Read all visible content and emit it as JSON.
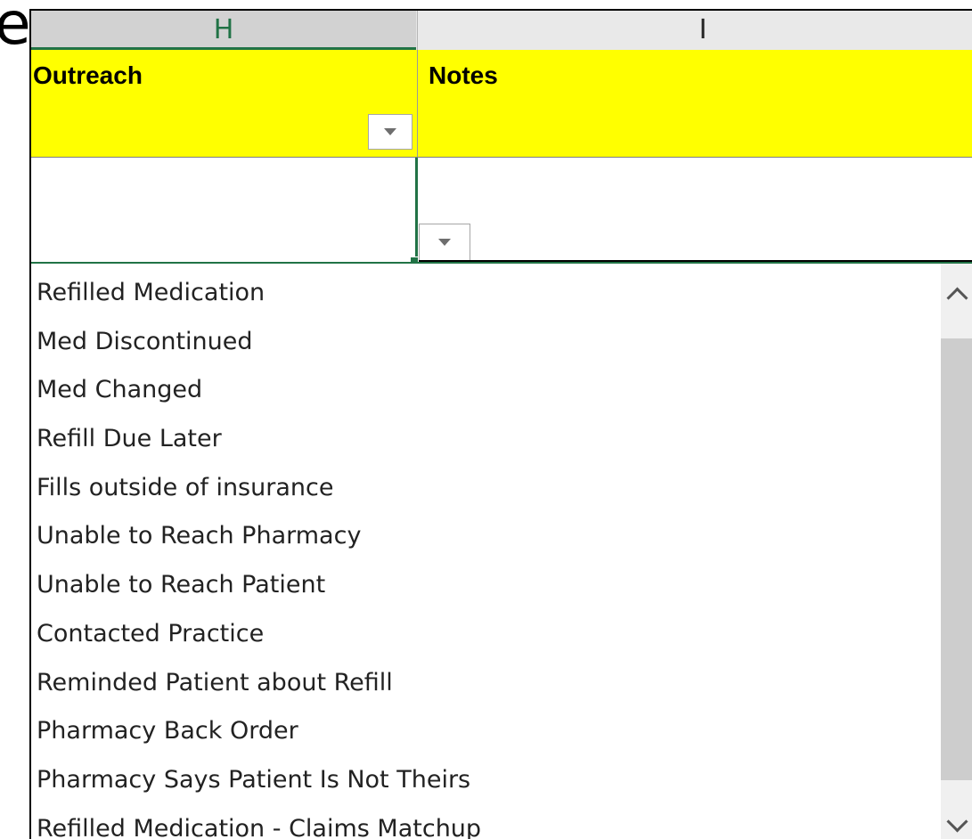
{
  "cropped_text": "e",
  "columns": [
    {
      "letter": "H"
    },
    {
      "letter": "I"
    }
  ],
  "headers": {
    "outreach": "Outreach",
    "notes": "Notes"
  },
  "colors": {
    "header_fill": "#ffff00",
    "selection_accent": "#217346"
  },
  "dropdown": {
    "items": [
      "Refilled Medication",
      "Med Discontinued",
      "Med Changed",
      "Refill Due Later",
      "Fills outside of insurance",
      "Unable to Reach Pharmacy",
      "Unable to Reach Patient",
      "Contacted Practice",
      "Reminded Patient about Refill",
      "Pharmacy Back Order",
      "Pharmacy Says Patient Is Not Theirs",
      "Refilled Medication - Claims Matchup"
    ]
  },
  "icons": {
    "filter": "chevron-down-icon",
    "scroll_up": "scroll-up-arrow-icon",
    "scroll_down": "scroll-down-arrow-icon"
  }
}
